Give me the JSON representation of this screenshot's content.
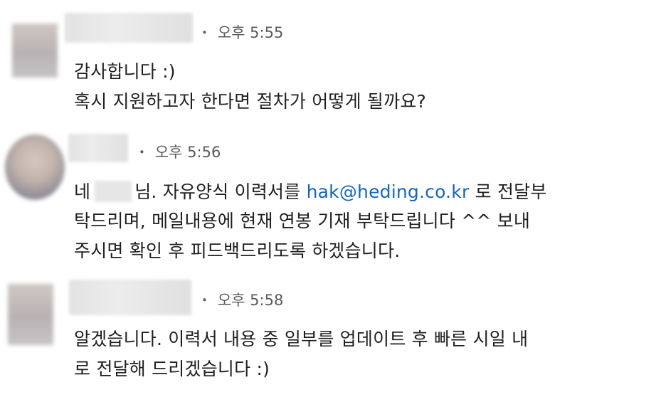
{
  "messages": [
    {
      "time": "오후 5:55",
      "lines": [
        "감사합니다 :)",
        "혹시 지원하고자 한다면 절차가 어떻게 될까요?"
      ]
    },
    {
      "time": "오후 5:56",
      "line1_prefix": "네",
      "line1_mid": "님. 자유양식 이력서를",
      "email": "hak@heding.co.kr",
      "line1_suffix": "로 전달부",
      "line2": "탁드리며, 메일내용에 현재 연봉 기재 부탁드립니다 ^^ 보내",
      "line3": "주시면 확인 후 피드백드리도록 하겠습니다."
    },
    {
      "time": "오후 5:58",
      "lines": [
        "알겠습니다. 이력서 내용 중 일부를 업데이트 후 빠른 시일 내",
        "로 전달해 드리겠습니다 :)"
      ]
    }
  ]
}
